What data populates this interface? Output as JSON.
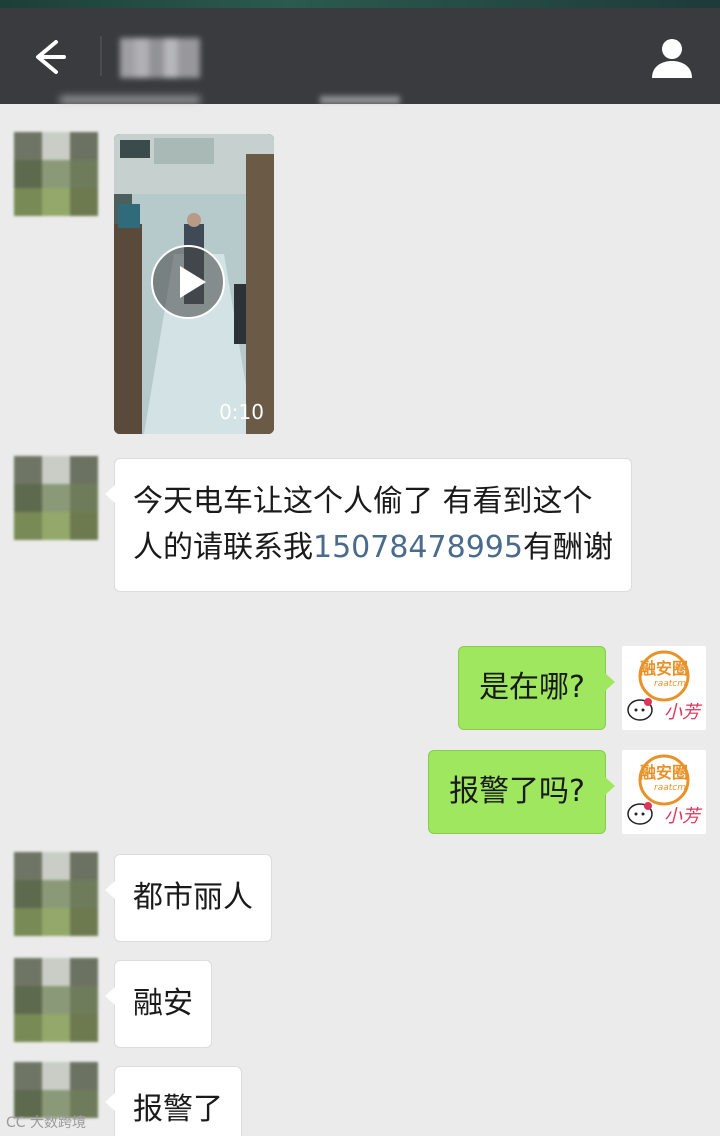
{
  "header": {
    "title": "■■■",
    "back_icon": "back-arrow-icon",
    "contact_icon": "person-icon"
  },
  "messages": [
    {
      "from": "contact",
      "type": "video",
      "duration": "0:10"
    },
    {
      "from": "contact",
      "type": "text",
      "text_before": "今天电车让这个人偷了  有看到这个人的请联系我",
      "phone": "15078478995",
      "text_after": "有酬谢"
    },
    {
      "from": "me",
      "type": "text",
      "text": "是在哪?"
    },
    {
      "from": "me",
      "type": "text",
      "text": "报警了吗?"
    },
    {
      "from": "contact",
      "type": "text",
      "text": "都市丽人"
    },
    {
      "from": "contact",
      "type": "text",
      "text": "融安"
    },
    {
      "from": "contact",
      "type": "text",
      "text": "报警了"
    }
  ],
  "my_avatar": {
    "logo_text": "融安圈",
    "logo_sub": "raatcm",
    "signature": "小芳"
  },
  "watermark": "大数跨境",
  "colors": {
    "header_bg": "#3a3b3f",
    "chat_bg": "#ebebeb",
    "incoming_bubble": "#ffffff",
    "outgoing_bubble": "#9ee75f",
    "phone_link": "#4a6b8c"
  }
}
